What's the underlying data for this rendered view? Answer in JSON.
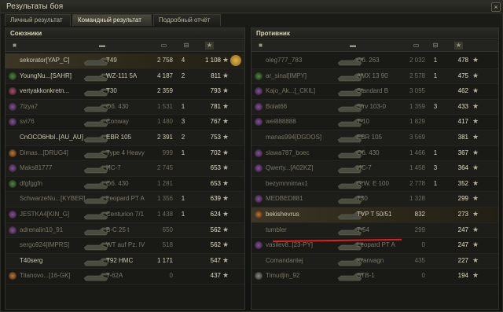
{
  "window": {
    "title": "Результаты боя",
    "close": "×"
  },
  "tabs": [
    {
      "label": "Личный результат",
      "selected": false
    },
    {
      "label": "Командный результат",
      "selected": true
    },
    {
      "label": "Подробный отчёт",
      "selected": false
    }
  ],
  "left": {
    "title": "Союзники",
    "rows": [
      {
        "badge": "none",
        "nick": "sekorator[YAP_C]",
        "tank": "T49",
        "damage": "2 758",
        "frags": "4",
        "xp": "1 108",
        "medal": true,
        "player": true,
        "dead": false
      },
      {
        "badge": "green",
        "nick": "YoungNu...[SAHR]",
        "tank": "WZ-111 5A",
        "damage": "4 187",
        "frags": "2",
        "xp": "811",
        "dead": false
      },
      {
        "badge": "pink",
        "nick": "vertyakkonkretn...",
        "tank": "T30",
        "damage": "2 359",
        "frags": "",
        "xp": "793",
        "dead": false
      },
      {
        "badge": "purple",
        "nick": "7lzya7",
        "tank": "Об. 430",
        "damage": "1 531",
        "frags": "1",
        "xp": "781",
        "dead": true
      },
      {
        "badge": "purple",
        "nick": "svi76",
        "tank": "Conway",
        "damage": "1 480",
        "frags": "3",
        "xp": "767",
        "dead": true
      },
      {
        "badge": "none",
        "nick": "CnOCO6HbI..[AU_AU]",
        "tank": "EBR 105",
        "damage": "2 391",
        "frags": "2",
        "xp": "753",
        "dead": false
      },
      {
        "badge": "orange",
        "nick": "Dimas...[DRUG4]",
        "tank": "Type 4 Heavy",
        "damage": "999",
        "frags": "1",
        "xp": "702",
        "dead": true
      },
      {
        "badge": "purple",
        "nick": "Maks81777",
        "tank": "ИС-7",
        "damage": "2 745",
        "frags": "",
        "xp": "653",
        "dead": true
      },
      {
        "badge": "green",
        "nick": "dfgfggfn",
        "tank": "Об. 430",
        "damage": "1 281",
        "frags": "",
        "xp": "653",
        "dead": true
      },
      {
        "badge": "none",
        "nick": "SchwarzeNu...[KYBER]",
        "tank": "Leopard PT A",
        "damage": "1 356",
        "frags": "1",
        "xp": "639",
        "dead": true
      },
      {
        "badge": "purple",
        "nick": "JESTKA4[KIN_G]",
        "tank": "Centurion 7/1",
        "damage": "1 438",
        "frags": "1",
        "xp": "624",
        "dead": true
      },
      {
        "badge": "purple",
        "nick": "adrenalin10_91",
        "tank": "B-C 25 t",
        "damage": "650",
        "frags": "",
        "xp": "562",
        "dead": true
      },
      {
        "badge": "none",
        "nick": "sergo924[IMPRS]",
        "tank": "WT auf Pz. IV",
        "damage": "518",
        "frags": "",
        "xp": "562",
        "dead": true
      },
      {
        "badge": "none",
        "nick": "T40serg",
        "tank": "T92 HMC",
        "damage": "1 171",
        "frags": "",
        "xp": "547",
        "dead": false
      },
      {
        "badge": "orange",
        "nick": "Titanovo...[16-GK]",
        "tank": "T-62A",
        "damage": "0",
        "frags": "",
        "xp": "437",
        "dead": true
      }
    ]
  },
  "right": {
    "title": "Противник",
    "rows": [
      {
        "badge": "none",
        "nick": "oleg777_783",
        "tank": "Об. 263",
        "damage": "2 032",
        "frags": "1",
        "xp": "478",
        "dead": true
      },
      {
        "badge": "green",
        "nick": "ar_sinal[IMPY]",
        "tank": "AMX 13 90",
        "damage": "2 578",
        "frags": "1",
        "xp": "475",
        "dead": true
      },
      {
        "badge": "purple",
        "nick": "Kajo_Ak...[_CKIL]",
        "tank": "Standard B",
        "damage": "3 095",
        "frags": "",
        "xp": "462",
        "dead": true
      },
      {
        "badge": "purple",
        "nick": "Bolat66",
        "tank": "Strv 103-0",
        "damage": "1 359",
        "frags": "3",
        "xp": "433",
        "dead": true
      },
      {
        "badge": "purple",
        "nick": "wel888888",
        "tank": "T-10",
        "damage": "1 829",
        "frags": "",
        "xp": "417",
        "dead": true
      },
      {
        "badge": "none",
        "nick": "manas994[DGDOS]",
        "tank": "EBR 105",
        "damage": "3 569",
        "frags": "",
        "xp": "381",
        "dead": true
      },
      {
        "badge": "purple",
        "nick": "slawa787_boec",
        "tank": "Об. 430",
        "damage": "1 466",
        "frags": "1",
        "xp": "367",
        "dead": true
      },
      {
        "badge": "purple",
        "nick": "Qwerty...[A02KZ]",
        "tank": "ИС-7",
        "damage": "1 458",
        "frags": "3",
        "xp": "364",
        "dead": true
      },
      {
        "badge": "none",
        "nick": "bezymnnimax1",
        "tank": "G.W. E 100",
        "damage": "2 778",
        "frags": "1",
        "xp": "352",
        "dead": true
      },
      {
        "badge": "purple",
        "nick": "MEDBED881",
        "tank": "T30",
        "damage": "1 328",
        "frags": "",
        "xp": "299",
        "dead": true
      },
      {
        "badge": "orange",
        "nick": "bekishevrus",
        "tank": "TVP T 50/51",
        "damage": "832",
        "frags": "",
        "xp": "273",
        "dead": false,
        "highlight": true
      },
      {
        "badge": "none",
        "nick": "tumbler",
        "tank": "T-54",
        "damage": "299",
        "frags": "",
        "xp": "247",
        "dead": true
      },
      {
        "badge": "purple",
        "nick": "vasilev8..[23-PY]",
        "tank": "Leopard PT A",
        "damage": "0",
        "frags": "",
        "xp": "247",
        "dead": true
      },
      {
        "badge": "none",
        "nick": "Comandantej",
        "tank": "Kranvagn",
        "damage": "435",
        "frags": "",
        "xp": "227",
        "dead": true
      },
      {
        "badge": "gray",
        "nick": "Timudjin_92",
        "tank": "STB-1",
        "damage": "0",
        "frags": "",
        "xp": "194",
        "dead": true
      }
    ]
  },
  "column_icons": [
    "tank-class-icon",
    "tank-icon",
    "damage-icon",
    "frags-icon",
    "star-icon"
  ],
  "badge_colors": {
    "green": "#4d8b3a",
    "pink": "#b44a6a",
    "purple": "#8a4fa3",
    "orange": "#c9782c",
    "gray": "#8a8a86"
  },
  "accent": "#e01e1e"
}
